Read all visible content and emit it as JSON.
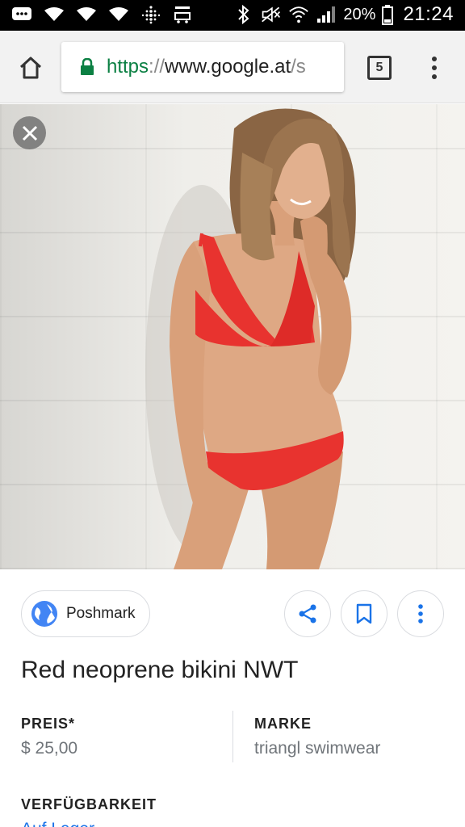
{
  "status_bar": {
    "left_icons": [
      "message-icon",
      "wifi-icon",
      "wifi-icon",
      "wifi-icon",
      "fitbit-icon",
      "amazon-cart-icon"
    ],
    "right_icons": [
      "bluetooth-icon",
      "mute-icon",
      "wifi-call-icon",
      "signal-icon",
      "battery-icon"
    ],
    "battery_percent": "20%",
    "time": "21:24"
  },
  "toolbar": {
    "url_scheme": "https",
    "url_separator": "://",
    "url_host": "www.google.at",
    "url_tail": "/s",
    "tab_count": "5"
  },
  "result": {
    "source": "Poshmark",
    "title": "Red neoprene bikini NWT",
    "price_label": "PREIS*",
    "price_value": "$ 25,00",
    "brand_label": "MARKE",
    "brand_value": "triangl swimwear",
    "availability_label": "VERFÜGBARKEIT",
    "availability_value": "Auf Lager"
  },
  "colors": {
    "url_green": "#0b8043",
    "accent_blue": "#1a73e8",
    "bikini_red": "#e8332f"
  }
}
